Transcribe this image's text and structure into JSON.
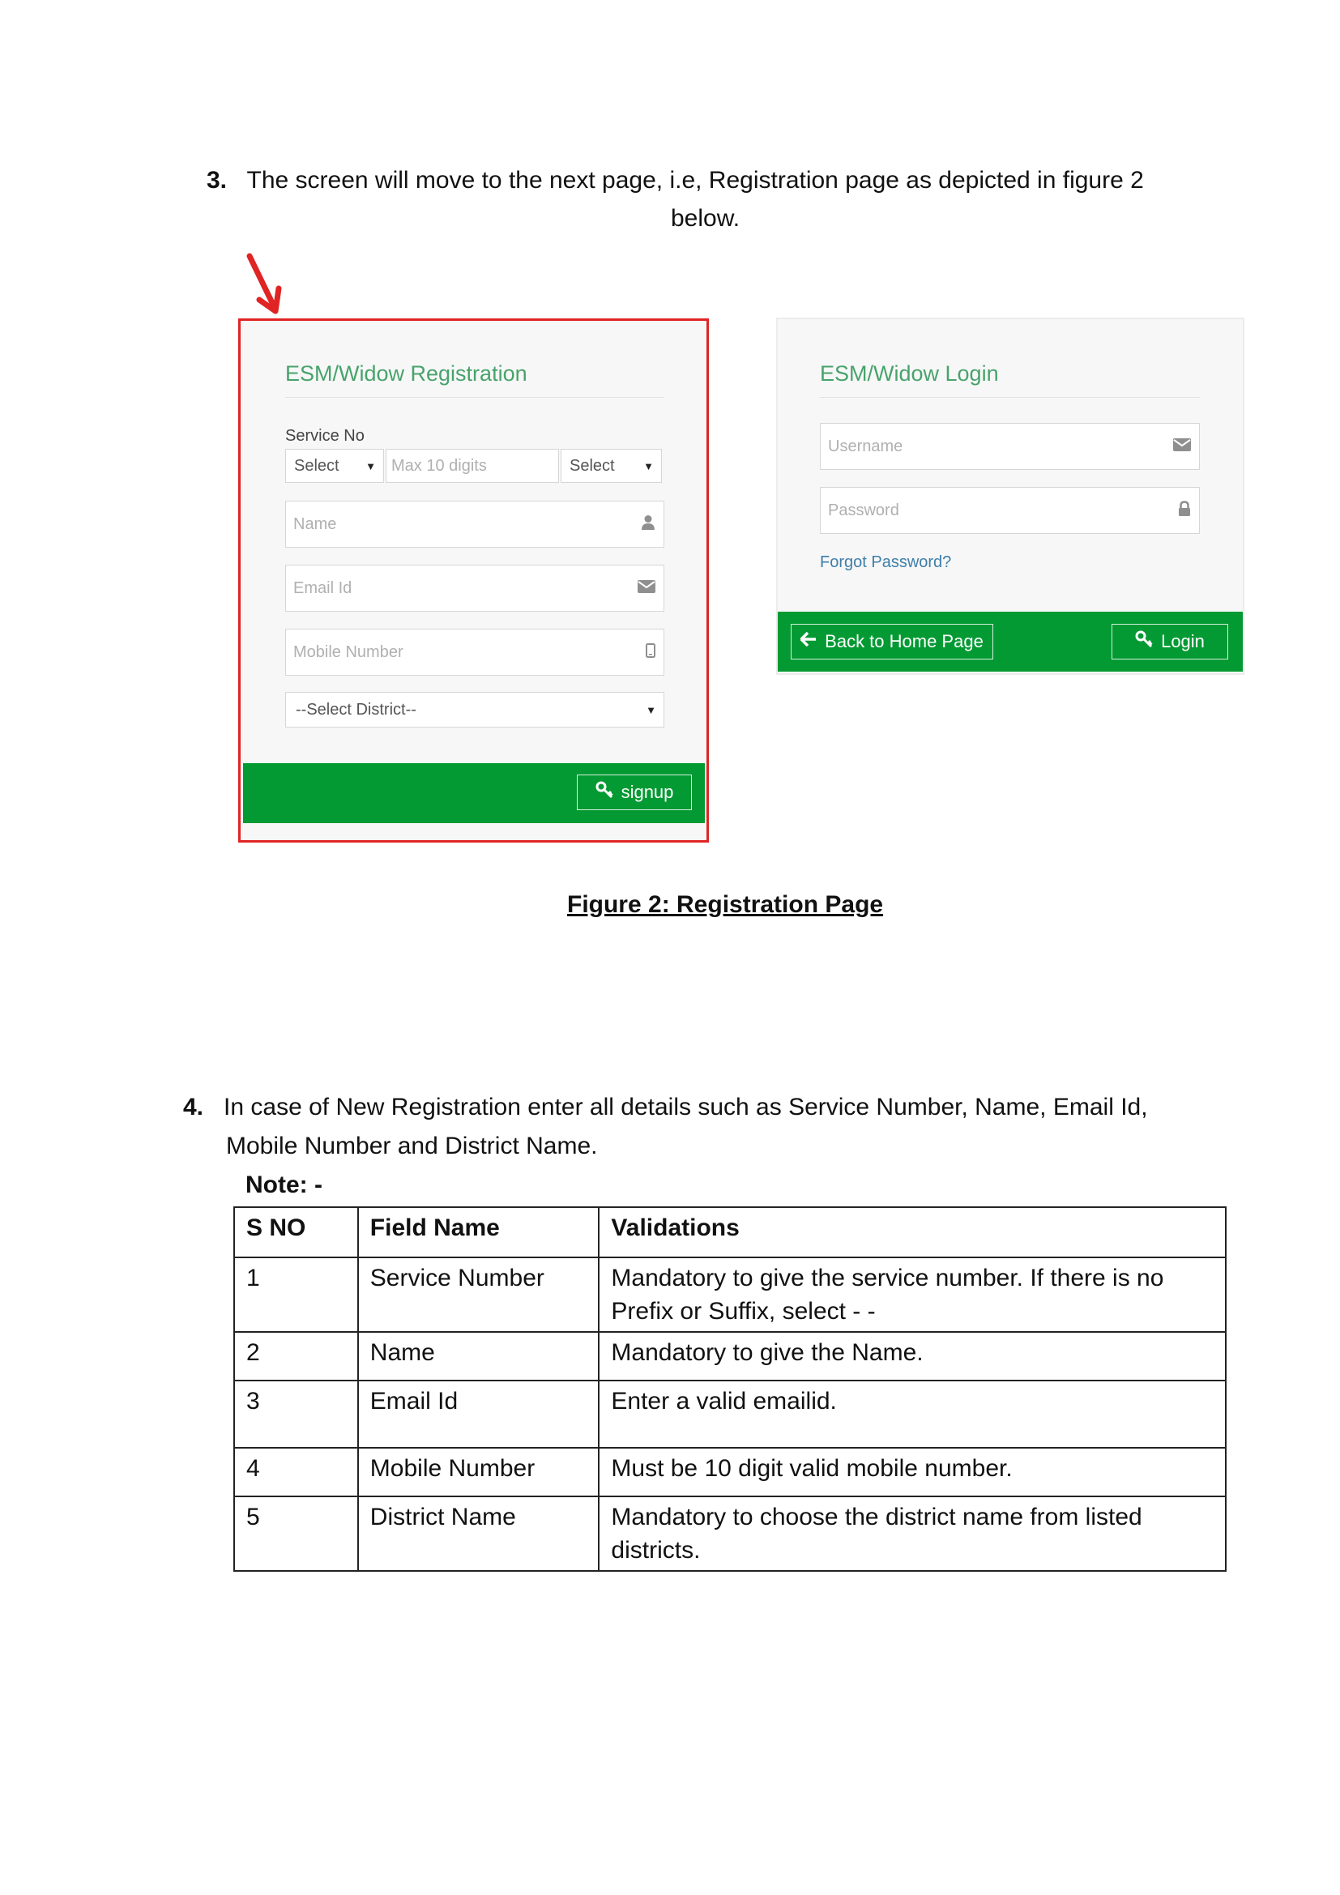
{
  "step3": {
    "number": "3.",
    "text_line1": "The screen will move to the next page, i.e, Registration page as depicted in figure 2",
    "text_line2": "below."
  },
  "registration_panel": {
    "title": "ESM/Widow Registration",
    "service_no_label": "Service No",
    "prefix_select": "Select",
    "service_no_placeholder": "Max 10 digits",
    "suffix_select": "Select",
    "name_placeholder": "Name",
    "email_placeholder": "Email Id",
    "mobile_placeholder": "Mobile Number",
    "district_select": "--Select District--",
    "signup_button": "signup",
    "highlight_color": "#e02424"
  },
  "login_panel": {
    "title": "ESM/Widow Login",
    "username_placeholder": "Username",
    "password_placeholder": "Password",
    "forgot_password_link": "Forgot Password?",
    "back_button": "Back to Home Page",
    "login_button": "Login"
  },
  "icons": {
    "user": "user-icon",
    "envelope": "envelope-icon",
    "mobile": "mobile-icon",
    "lock": "lock-icon",
    "key": "key-icon",
    "arrow_left": "arrow-left-icon",
    "caret": "caret-down-icon",
    "pointer_arrow": "red-arrow-icon"
  },
  "colors": {
    "brand_green": "#049a33",
    "title_green": "#48a36c",
    "link_blue": "#3e7ea9",
    "highlight_red": "#e02424"
  },
  "figure_caption": "Figure 2: Registration Page",
  "step4": {
    "number": "4.",
    "text_line1": "In case of New Registration enter all details such as Service Number, Name, Email Id,",
    "text_line2": "Mobile Number and District Name.",
    "note_label": "Note: -"
  },
  "validation_table": {
    "headers": [
      "S NO",
      "Field Name",
      "Validations"
    ],
    "rows": [
      {
        "sno": "1",
        "field": "Service Number",
        "validation": "Mandatory to give the service number. If there is no Prefix or Suffix, select - -"
      },
      {
        "sno": "2",
        "field": "Name",
        "validation": "Mandatory to give the Name."
      },
      {
        "sno": "3",
        "field": "Email Id",
        "validation": "Enter a valid emailid."
      },
      {
        "sno": "4",
        "field": "Mobile Number",
        "validation": "Must be 10 digit valid mobile number."
      },
      {
        "sno": "5",
        "field": "District Name",
        "validation": "Mandatory to choose the district name from listed districts."
      }
    ]
  }
}
